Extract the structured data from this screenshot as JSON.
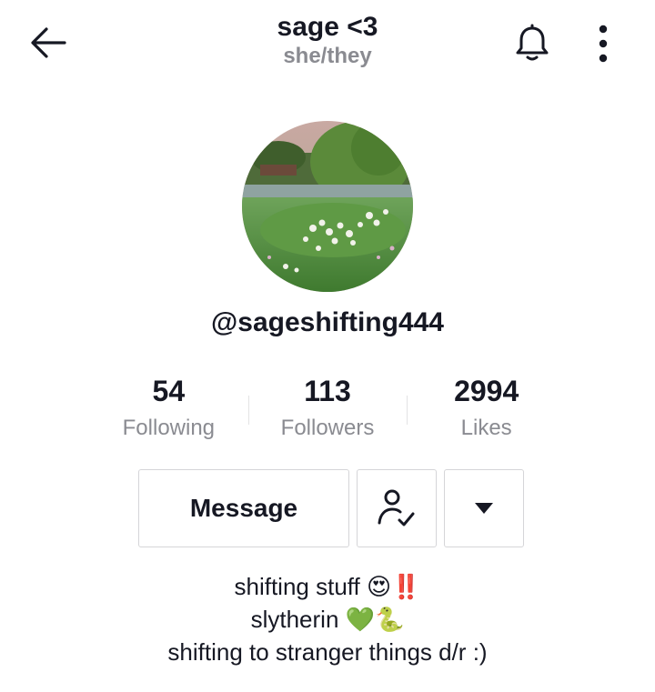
{
  "header": {
    "title": "sage <3",
    "pronouns": "she/they",
    "back_icon": "arrow-left-icon",
    "bell_icon": "bell-icon",
    "more_icon": "more-vertical-icon"
  },
  "profile": {
    "username": "@sageshifting444",
    "avatar_description": "profile photo"
  },
  "stats": [
    {
      "number": "54",
      "label": "Following"
    },
    {
      "number": "113",
      "label": "Followers"
    },
    {
      "number": "2994",
      "label": "Likes"
    }
  ],
  "actions": {
    "message_label": "Message",
    "following_icon": "user-check-icon",
    "dropdown_icon": "caret-down-icon"
  },
  "bio": {
    "line1_text": "shifting stuff",
    "line1_emoji": "😍‼️",
    "line2_text": "slytherin",
    "line2_emoji": "💚🐍",
    "line3_text": "shifting to stranger things d/r :)"
  },
  "colors": {
    "text_primary": "#161823",
    "text_secondary": "#8a8b91",
    "border": "#d5d5d8"
  }
}
